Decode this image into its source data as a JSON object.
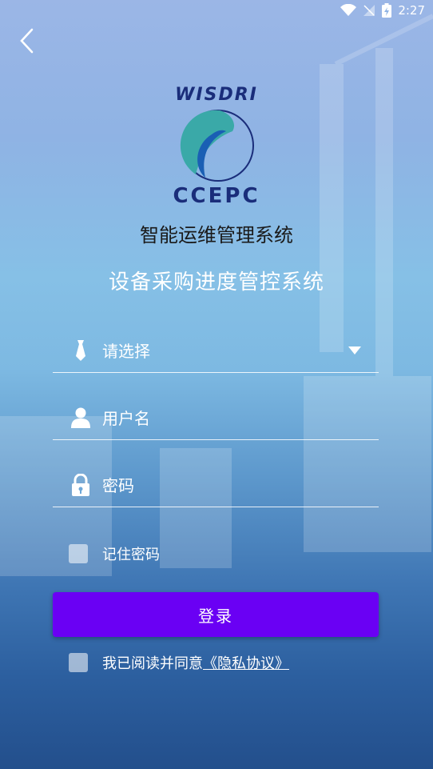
{
  "status_bar": {
    "time": "2:27"
  },
  "logo": {
    "top_text": "WISDRI",
    "bottom_text": "CCEPC"
  },
  "app_title": "智能运维管理系统",
  "sub_title": "设备采购进度管控系统",
  "form": {
    "select_label": "请选择",
    "username_placeholder": "用户名",
    "password_placeholder": "密码",
    "remember_label": "记住密码",
    "login_label": "登录",
    "agree_prefix": "我已阅读并同意",
    "privacy_link": "《隐私协议》"
  },
  "colors": {
    "button": "#6a00f4",
    "brand_blue": "#1a2d7a",
    "logo_teal": "#3aa9a8"
  }
}
